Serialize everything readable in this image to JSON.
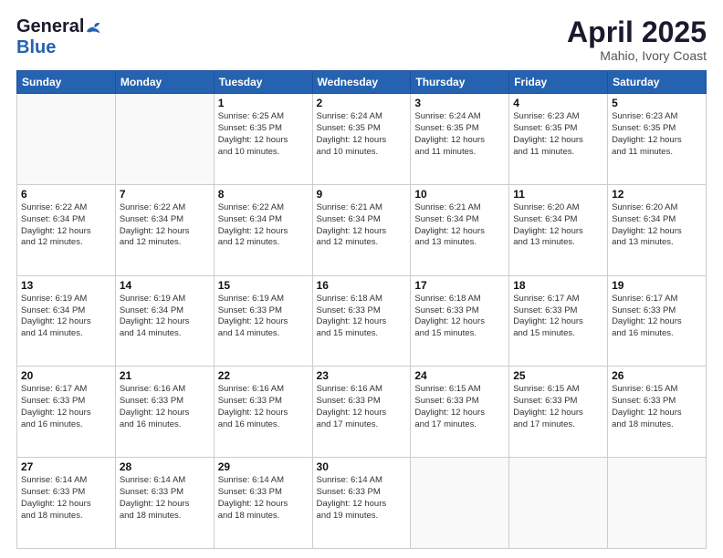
{
  "header": {
    "logo_general": "General",
    "logo_blue": "Blue",
    "month_title": "April 2025",
    "subtitle": "Mahio, Ivory Coast"
  },
  "days_of_week": [
    "Sunday",
    "Monday",
    "Tuesday",
    "Wednesday",
    "Thursday",
    "Friday",
    "Saturday"
  ],
  "weeks": [
    [
      {
        "day": "",
        "info": ""
      },
      {
        "day": "",
        "info": ""
      },
      {
        "day": "1",
        "info": "Sunrise: 6:25 AM\nSunset: 6:35 PM\nDaylight: 12 hours\nand 10 minutes."
      },
      {
        "day": "2",
        "info": "Sunrise: 6:24 AM\nSunset: 6:35 PM\nDaylight: 12 hours\nand 10 minutes."
      },
      {
        "day": "3",
        "info": "Sunrise: 6:24 AM\nSunset: 6:35 PM\nDaylight: 12 hours\nand 11 minutes."
      },
      {
        "day": "4",
        "info": "Sunrise: 6:23 AM\nSunset: 6:35 PM\nDaylight: 12 hours\nand 11 minutes."
      },
      {
        "day": "5",
        "info": "Sunrise: 6:23 AM\nSunset: 6:35 PM\nDaylight: 12 hours\nand 11 minutes."
      }
    ],
    [
      {
        "day": "6",
        "info": "Sunrise: 6:22 AM\nSunset: 6:34 PM\nDaylight: 12 hours\nand 12 minutes."
      },
      {
        "day": "7",
        "info": "Sunrise: 6:22 AM\nSunset: 6:34 PM\nDaylight: 12 hours\nand 12 minutes."
      },
      {
        "day": "8",
        "info": "Sunrise: 6:22 AM\nSunset: 6:34 PM\nDaylight: 12 hours\nand 12 minutes."
      },
      {
        "day": "9",
        "info": "Sunrise: 6:21 AM\nSunset: 6:34 PM\nDaylight: 12 hours\nand 12 minutes."
      },
      {
        "day": "10",
        "info": "Sunrise: 6:21 AM\nSunset: 6:34 PM\nDaylight: 12 hours\nand 13 minutes."
      },
      {
        "day": "11",
        "info": "Sunrise: 6:20 AM\nSunset: 6:34 PM\nDaylight: 12 hours\nand 13 minutes."
      },
      {
        "day": "12",
        "info": "Sunrise: 6:20 AM\nSunset: 6:34 PM\nDaylight: 12 hours\nand 13 minutes."
      }
    ],
    [
      {
        "day": "13",
        "info": "Sunrise: 6:19 AM\nSunset: 6:34 PM\nDaylight: 12 hours\nand 14 minutes."
      },
      {
        "day": "14",
        "info": "Sunrise: 6:19 AM\nSunset: 6:34 PM\nDaylight: 12 hours\nand 14 minutes."
      },
      {
        "day": "15",
        "info": "Sunrise: 6:19 AM\nSunset: 6:33 PM\nDaylight: 12 hours\nand 14 minutes."
      },
      {
        "day": "16",
        "info": "Sunrise: 6:18 AM\nSunset: 6:33 PM\nDaylight: 12 hours\nand 15 minutes."
      },
      {
        "day": "17",
        "info": "Sunrise: 6:18 AM\nSunset: 6:33 PM\nDaylight: 12 hours\nand 15 minutes."
      },
      {
        "day": "18",
        "info": "Sunrise: 6:17 AM\nSunset: 6:33 PM\nDaylight: 12 hours\nand 15 minutes."
      },
      {
        "day": "19",
        "info": "Sunrise: 6:17 AM\nSunset: 6:33 PM\nDaylight: 12 hours\nand 16 minutes."
      }
    ],
    [
      {
        "day": "20",
        "info": "Sunrise: 6:17 AM\nSunset: 6:33 PM\nDaylight: 12 hours\nand 16 minutes."
      },
      {
        "day": "21",
        "info": "Sunrise: 6:16 AM\nSunset: 6:33 PM\nDaylight: 12 hours\nand 16 minutes."
      },
      {
        "day": "22",
        "info": "Sunrise: 6:16 AM\nSunset: 6:33 PM\nDaylight: 12 hours\nand 16 minutes."
      },
      {
        "day": "23",
        "info": "Sunrise: 6:16 AM\nSunset: 6:33 PM\nDaylight: 12 hours\nand 17 minutes."
      },
      {
        "day": "24",
        "info": "Sunrise: 6:15 AM\nSunset: 6:33 PM\nDaylight: 12 hours\nand 17 minutes."
      },
      {
        "day": "25",
        "info": "Sunrise: 6:15 AM\nSunset: 6:33 PM\nDaylight: 12 hours\nand 17 minutes."
      },
      {
        "day": "26",
        "info": "Sunrise: 6:15 AM\nSunset: 6:33 PM\nDaylight: 12 hours\nand 18 minutes."
      }
    ],
    [
      {
        "day": "27",
        "info": "Sunrise: 6:14 AM\nSunset: 6:33 PM\nDaylight: 12 hours\nand 18 minutes."
      },
      {
        "day": "28",
        "info": "Sunrise: 6:14 AM\nSunset: 6:33 PM\nDaylight: 12 hours\nand 18 minutes."
      },
      {
        "day": "29",
        "info": "Sunrise: 6:14 AM\nSunset: 6:33 PM\nDaylight: 12 hours\nand 18 minutes."
      },
      {
        "day": "30",
        "info": "Sunrise: 6:14 AM\nSunset: 6:33 PM\nDaylight: 12 hours\nand 19 minutes."
      },
      {
        "day": "",
        "info": ""
      },
      {
        "day": "",
        "info": ""
      },
      {
        "day": "",
        "info": ""
      }
    ]
  ]
}
